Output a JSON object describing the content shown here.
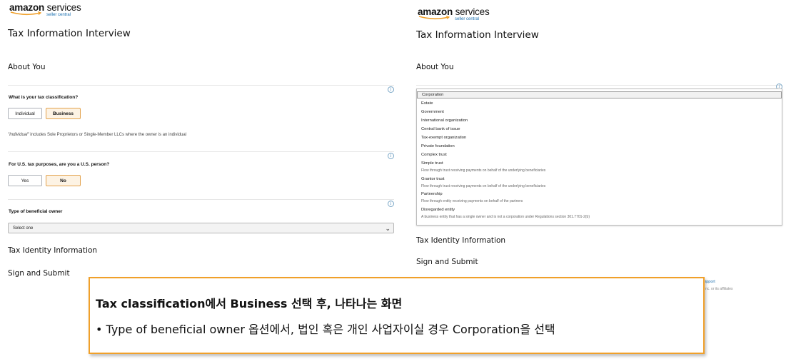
{
  "left": {
    "brand": {
      "word": "amazon",
      "service": "services",
      "sub": "seller central"
    },
    "title": "Tax Information Interview",
    "section_about": "About You",
    "q_classification": "What is your tax classification?",
    "btn_individual": "Individual",
    "btn_business": "Business",
    "hint_quote": "\"Individual\"",
    "hint_rest": " includes Sole Proprietors or Single-Member LLCs where the owner is an individual",
    "q_us_person": "For U.S. tax purposes, are you a U.S. person?",
    "btn_yes": "Yes",
    "btn_no": "No",
    "q_owner_type": "Type of beneficial owner",
    "select_value": "Select one",
    "section_identity": "Tax Identity Information",
    "section_sign": "Sign and Submit",
    "info_glyph": "i"
  },
  "right": {
    "brand": {
      "word": "amazon",
      "service": "services",
      "sub": "seller central"
    },
    "title": "Tax Information Interview",
    "section_about": "About You",
    "options": [
      {
        "label": "Corporation",
        "desc": ""
      },
      {
        "label": "Estate",
        "desc": ""
      },
      {
        "label": "Government",
        "desc": ""
      },
      {
        "label": "International organization",
        "desc": ""
      },
      {
        "label": "Central bank of issue",
        "desc": ""
      },
      {
        "label": "Tax-exempt organization",
        "desc": ""
      },
      {
        "label": "Private foundation",
        "desc": ""
      },
      {
        "label": "Complex trust",
        "desc": ""
      },
      {
        "label": "Simple trust",
        "desc": "Flow through trust receiving payments on behalf of the underlying beneficiaries"
      },
      {
        "label": "Grantor trust",
        "desc": "Flow through trust receiving payments on behalf of the underlying beneficiaries"
      },
      {
        "label": "Partnership",
        "desc": "Flow through entity receiving payments on behalf of the partners"
      },
      {
        "label": "Disregarded entity",
        "desc": "A business entity that has a single owner and is not a corporation under Regulations section 301.7701-2(b)"
      }
    ],
    "selected_option": "Corporation",
    "section_identity": "Tax Identity Information",
    "section_sign": "Sign and Submit",
    "footer_link": "ipport",
    "footer_text": "nc. or its affiliates",
    "info_glyph": "i"
  },
  "callout": {
    "title": "Tax classification에서 Business 선택 후, 나타나는 화면",
    "bullet_mark": "•",
    "bullet": "Type of beneficial owner 옵션에서, 법인 혹은 개인 사업자이실 경우 Corporation을 선택"
  },
  "colors": {
    "accent": "#f0a02a",
    "selected_bg": "#fdf3e4",
    "link": "#1a6fb0"
  }
}
